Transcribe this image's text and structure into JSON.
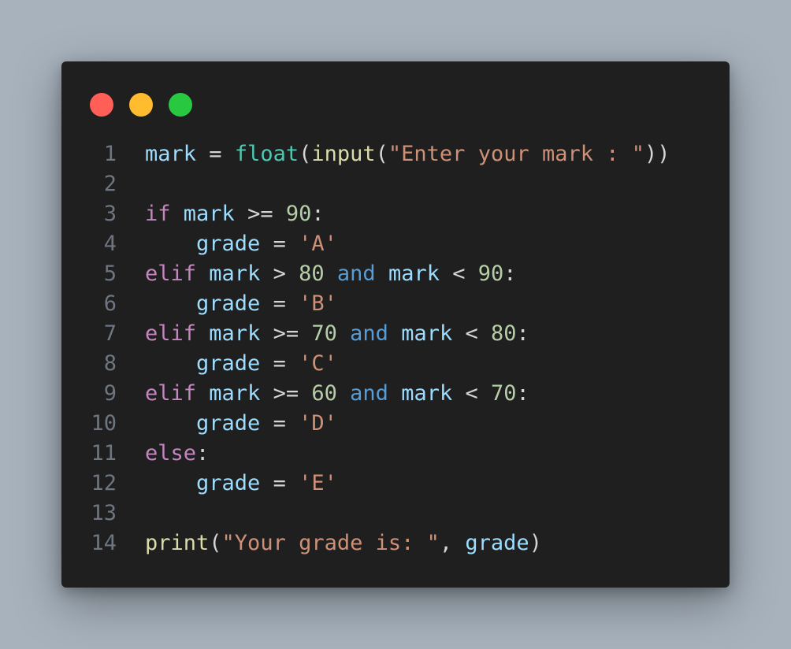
{
  "window": {
    "traffic_lights": {
      "red": "#ff5f57",
      "yellow": "#febc2e",
      "green": "#28c840"
    },
    "background": "#1f1f1f"
  },
  "code": {
    "language": "python",
    "lines": [
      {
        "number": "1",
        "tokens": [
          {
            "t": "mark",
            "k": "var"
          },
          {
            "t": " = ",
            "k": "punc"
          },
          {
            "t": "float",
            "k": "builtin"
          },
          {
            "t": "(",
            "k": "punc"
          },
          {
            "t": "input",
            "k": "fn"
          },
          {
            "t": "(",
            "k": "punc"
          },
          {
            "t": "\"Enter your mark : \"",
            "k": "str"
          },
          {
            "t": "))",
            "k": "punc"
          }
        ]
      },
      {
        "number": "2",
        "tokens": []
      },
      {
        "number": "3",
        "tokens": [
          {
            "t": "if",
            "k": "kw"
          },
          {
            "t": " ",
            "k": "punc"
          },
          {
            "t": "mark",
            "k": "var"
          },
          {
            "t": " >= ",
            "k": "punc"
          },
          {
            "t": "90",
            "k": "num"
          },
          {
            "t": ":",
            "k": "punc"
          }
        ]
      },
      {
        "number": "4",
        "tokens": [
          {
            "t": "    ",
            "k": "punc"
          },
          {
            "t": "grade",
            "k": "var"
          },
          {
            "t": " = ",
            "k": "punc"
          },
          {
            "t": "'A'",
            "k": "str"
          }
        ]
      },
      {
        "number": "5",
        "tokens": [
          {
            "t": "elif",
            "k": "kw"
          },
          {
            "t": " ",
            "k": "punc"
          },
          {
            "t": "mark",
            "k": "var"
          },
          {
            "t": " > ",
            "k": "punc"
          },
          {
            "t": "80",
            "k": "num"
          },
          {
            "t": " ",
            "k": "punc"
          },
          {
            "t": "and",
            "k": "op-kw"
          },
          {
            "t": " ",
            "k": "punc"
          },
          {
            "t": "mark",
            "k": "var"
          },
          {
            "t": " < ",
            "k": "punc"
          },
          {
            "t": "90",
            "k": "num"
          },
          {
            "t": ":",
            "k": "punc"
          }
        ]
      },
      {
        "number": "6",
        "tokens": [
          {
            "t": "    ",
            "k": "punc"
          },
          {
            "t": "grade",
            "k": "var"
          },
          {
            "t": " = ",
            "k": "punc"
          },
          {
            "t": "'B'",
            "k": "str"
          }
        ]
      },
      {
        "number": "7",
        "tokens": [
          {
            "t": "elif",
            "k": "kw"
          },
          {
            "t": " ",
            "k": "punc"
          },
          {
            "t": "mark",
            "k": "var"
          },
          {
            "t": " >= ",
            "k": "punc"
          },
          {
            "t": "70",
            "k": "num"
          },
          {
            "t": " ",
            "k": "punc"
          },
          {
            "t": "and",
            "k": "op-kw"
          },
          {
            "t": " ",
            "k": "punc"
          },
          {
            "t": "mark",
            "k": "var"
          },
          {
            "t": " < ",
            "k": "punc"
          },
          {
            "t": "80",
            "k": "num"
          },
          {
            "t": ":",
            "k": "punc"
          }
        ]
      },
      {
        "number": "8",
        "tokens": [
          {
            "t": "    ",
            "k": "punc"
          },
          {
            "t": "grade",
            "k": "var"
          },
          {
            "t": " = ",
            "k": "punc"
          },
          {
            "t": "'C'",
            "k": "str"
          }
        ]
      },
      {
        "number": "9",
        "tokens": [
          {
            "t": "elif",
            "k": "kw"
          },
          {
            "t": " ",
            "k": "punc"
          },
          {
            "t": "mark",
            "k": "var"
          },
          {
            "t": " >= ",
            "k": "punc"
          },
          {
            "t": "60",
            "k": "num"
          },
          {
            "t": " ",
            "k": "punc"
          },
          {
            "t": "and",
            "k": "op-kw"
          },
          {
            "t": " ",
            "k": "punc"
          },
          {
            "t": "mark",
            "k": "var"
          },
          {
            "t": " < ",
            "k": "punc"
          },
          {
            "t": "70",
            "k": "num"
          },
          {
            "t": ":",
            "k": "punc"
          }
        ]
      },
      {
        "number": "10",
        "tokens": [
          {
            "t": "    ",
            "k": "punc"
          },
          {
            "t": "grade",
            "k": "var"
          },
          {
            "t": " = ",
            "k": "punc"
          },
          {
            "t": "'D'",
            "k": "str"
          }
        ]
      },
      {
        "number": "11",
        "tokens": [
          {
            "t": "else",
            "k": "kw"
          },
          {
            "t": ":",
            "k": "punc"
          }
        ]
      },
      {
        "number": "12",
        "tokens": [
          {
            "t": "    ",
            "k": "punc"
          },
          {
            "t": "grade",
            "k": "var"
          },
          {
            "t": " = ",
            "k": "punc"
          },
          {
            "t": "'E'",
            "k": "str"
          }
        ]
      },
      {
        "number": "13",
        "tokens": []
      },
      {
        "number": "14",
        "tokens": [
          {
            "t": "print",
            "k": "fn"
          },
          {
            "t": "(",
            "k": "punc"
          },
          {
            "t": "\"Your grade is: \"",
            "k": "str"
          },
          {
            "t": ", ",
            "k": "punc"
          },
          {
            "t": "grade",
            "k": "var"
          },
          {
            "t": ")",
            "k": "punc"
          }
        ]
      }
    ]
  }
}
